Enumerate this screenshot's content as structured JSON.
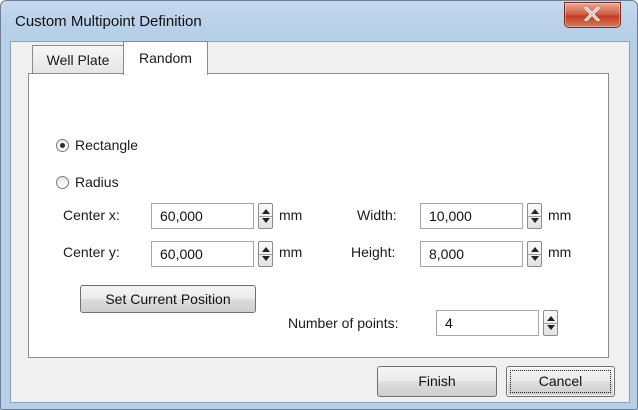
{
  "window": {
    "title": "Custom Multipoint Definition",
    "close_glyph": "x"
  },
  "tabs": [
    {
      "label": "Well Plate",
      "active": false
    },
    {
      "label": "Random",
      "active": true
    }
  ],
  "shape": {
    "options": [
      {
        "label": "Rectangle",
        "selected": true
      },
      {
        "label": "Radius",
        "selected": false
      }
    ]
  },
  "fields": {
    "center_x": {
      "label": "Center x:",
      "value": "60,000",
      "unit": "mm"
    },
    "center_y": {
      "label": "Center y:",
      "value": "60,000",
      "unit": "mm"
    },
    "width": {
      "label": "Width:",
      "value": "10,000",
      "unit": "mm"
    },
    "height": {
      "label": "Height:",
      "value": "8,000",
      "unit": "mm"
    },
    "num_points": {
      "label": "Number of points:",
      "value": "4"
    }
  },
  "buttons": {
    "set_position": "Set Current Position",
    "finish": "Finish",
    "cancel": "Cancel"
  }
}
